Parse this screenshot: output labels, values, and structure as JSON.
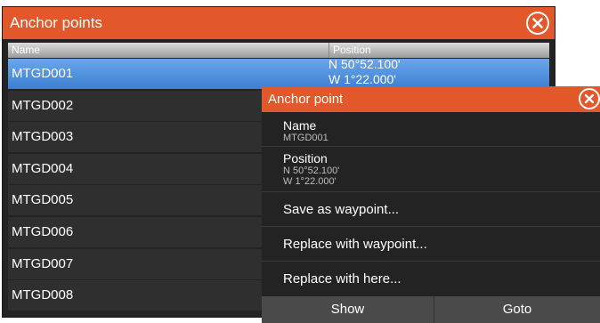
{
  "window": {
    "title": "Anchor points",
    "columns": {
      "name": "Name",
      "position": "Position"
    }
  },
  "rows": [
    {
      "name": "MTGD001",
      "lat": "N  50°52.100'",
      "lon": "W    1°22.000'"
    },
    {
      "name": "MTGD002"
    },
    {
      "name": "MTGD003"
    },
    {
      "name": "MTGD004"
    },
    {
      "name": "MTGD005"
    },
    {
      "name": "MTGD006"
    },
    {
      "name": "MTGD007"
    },
    {
      "name": "MTGD008"
    }
  ],
  "dialog": {
    "title": "Anchor point",
    "name_label": "Name",
    "name_value": "MTGD001",
    "position_label": "Position",
    "position_lat": "N  50°52.100'",
    "position_lon": "W   1°22.000'",
    "actions": [
      "Save as waypoint...",
      "Replace with waypoint...",
      "Replace with here..."
    ],
    "buttons": {
      "show": "Show",
      "goto": "Goto"
    }
  },
  "colors": {
    "accent": "#e2582a",
    "selection": "#4a8ee0",
    "panel": "#232323"
  },
  "icons": {
    "close": "close-circle-icon"
  }
}
